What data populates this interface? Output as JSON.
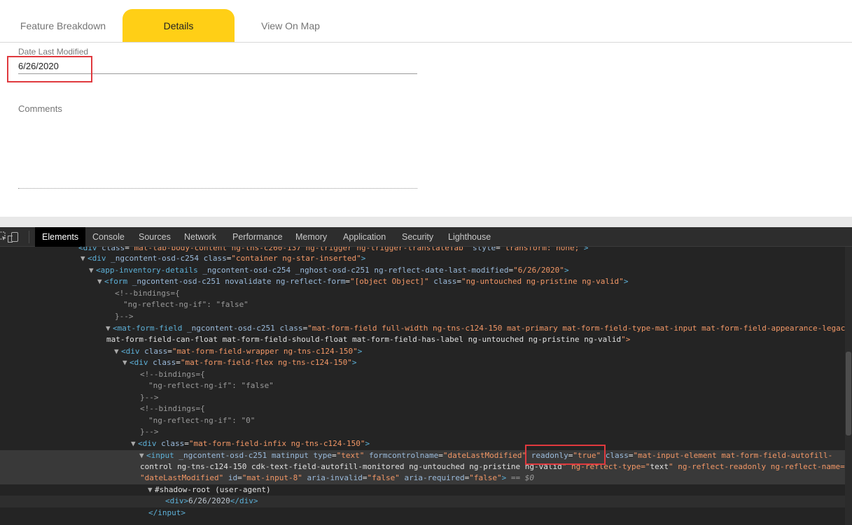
{
  "tabs": [
    {
      "label": "Feature Breakdown"
    },
    {
      "label": "Details"
    },
    {
      "label": "View On Map"
    }
  ],
  "colors": {
    "active_tab": "#ffcf16",
    "highlight": "#e0393e"
  },
  "form": {
    "date_label": "Date Last Modified",
    "date_value": "6/26/2020",
    "comments_label": "Comments"
  },
  "devtools": {
    "tabs": [
      "Elements",
      "Console",
      "Sources",
      "Network",
      "Performance",
      "Memory",
      "Application",
      "Security",
      "Lighthouse"
    ],
    "icons": [
      "inspect-element-icon",
      "device-toolbar-icon"
    ],
    "lines": [
      "<div class=\"mat-tab-body-content ng-tns-c260-137 ng-trigger ng-trigger-translateTab\" style=\"transform: none;\">",
      "<div _ngcontent-osd-c254 class=\"container ng-star-inserted\">",
      "<app-inventory-details _ngcontent-osd-c254 _nghost-osd-c251 ng-reflect-date-last-modified=\"6/26/2020\">",
      "<form _ngcontent-osd-c251 novalidate ng-reflect-form=\"[object Object]\" class=\"ng-untouched ng-pristine ng-valid\">",
      "<!--bindings={",
      "\"ng-reflect-ng-if\": \"false\"",
      "}-->",
      "<mat-form-field _ngcontent-osd-c251 class=\"mat-form-field full-width ng-tns-c124-150 mat-primary mat-form-field-type-mat-input mat-form-field-appearance-legacy",
      "mat-form-field-can-float mat-form-field-should-float mat-form-field-has-label ng-untouched ng-pristine ng-valid\">",
      "<div class=\"mat-form-field-wrapper ng-tns-c124-150\">",
      "<div class=\"mat-form-field-flex ng-tns-c124-150\">",
      "<!--bindings={",
      "\"ng-reflect-ng-if\": \"false\"",
      "}-->",
      "<!--bindings={",
      "\"ng-reflect-ng-if\": \"0\"",
      "}-->",
      "<div class=\"mat-form-field-infix ng-tns-c124-150\">",
      "<input _ngcontent-osd-c251 matinput type=\"text\" formcontrolname=\"dateLastModified\" readonly=\"true\" class=\"mat-input-element mat-form-field-autofill-",
      "control ng-tns-c124-150 cdk-text-field-autofill-monitored ng-untouched ng-pristine ng-valid\" ng-reflect-type=\"text\" ng-reflect-readonly ng-reflect-name=",
      "\"dateLastModified\" id=\"mat-input-8\" aria-invalid=\"false\" aria-required=\"false\"> == $0",
      "#shadow-root (user-agent)",
      "<div>6/26/2020</div>",
      "</input>"
    ]
  }
}
